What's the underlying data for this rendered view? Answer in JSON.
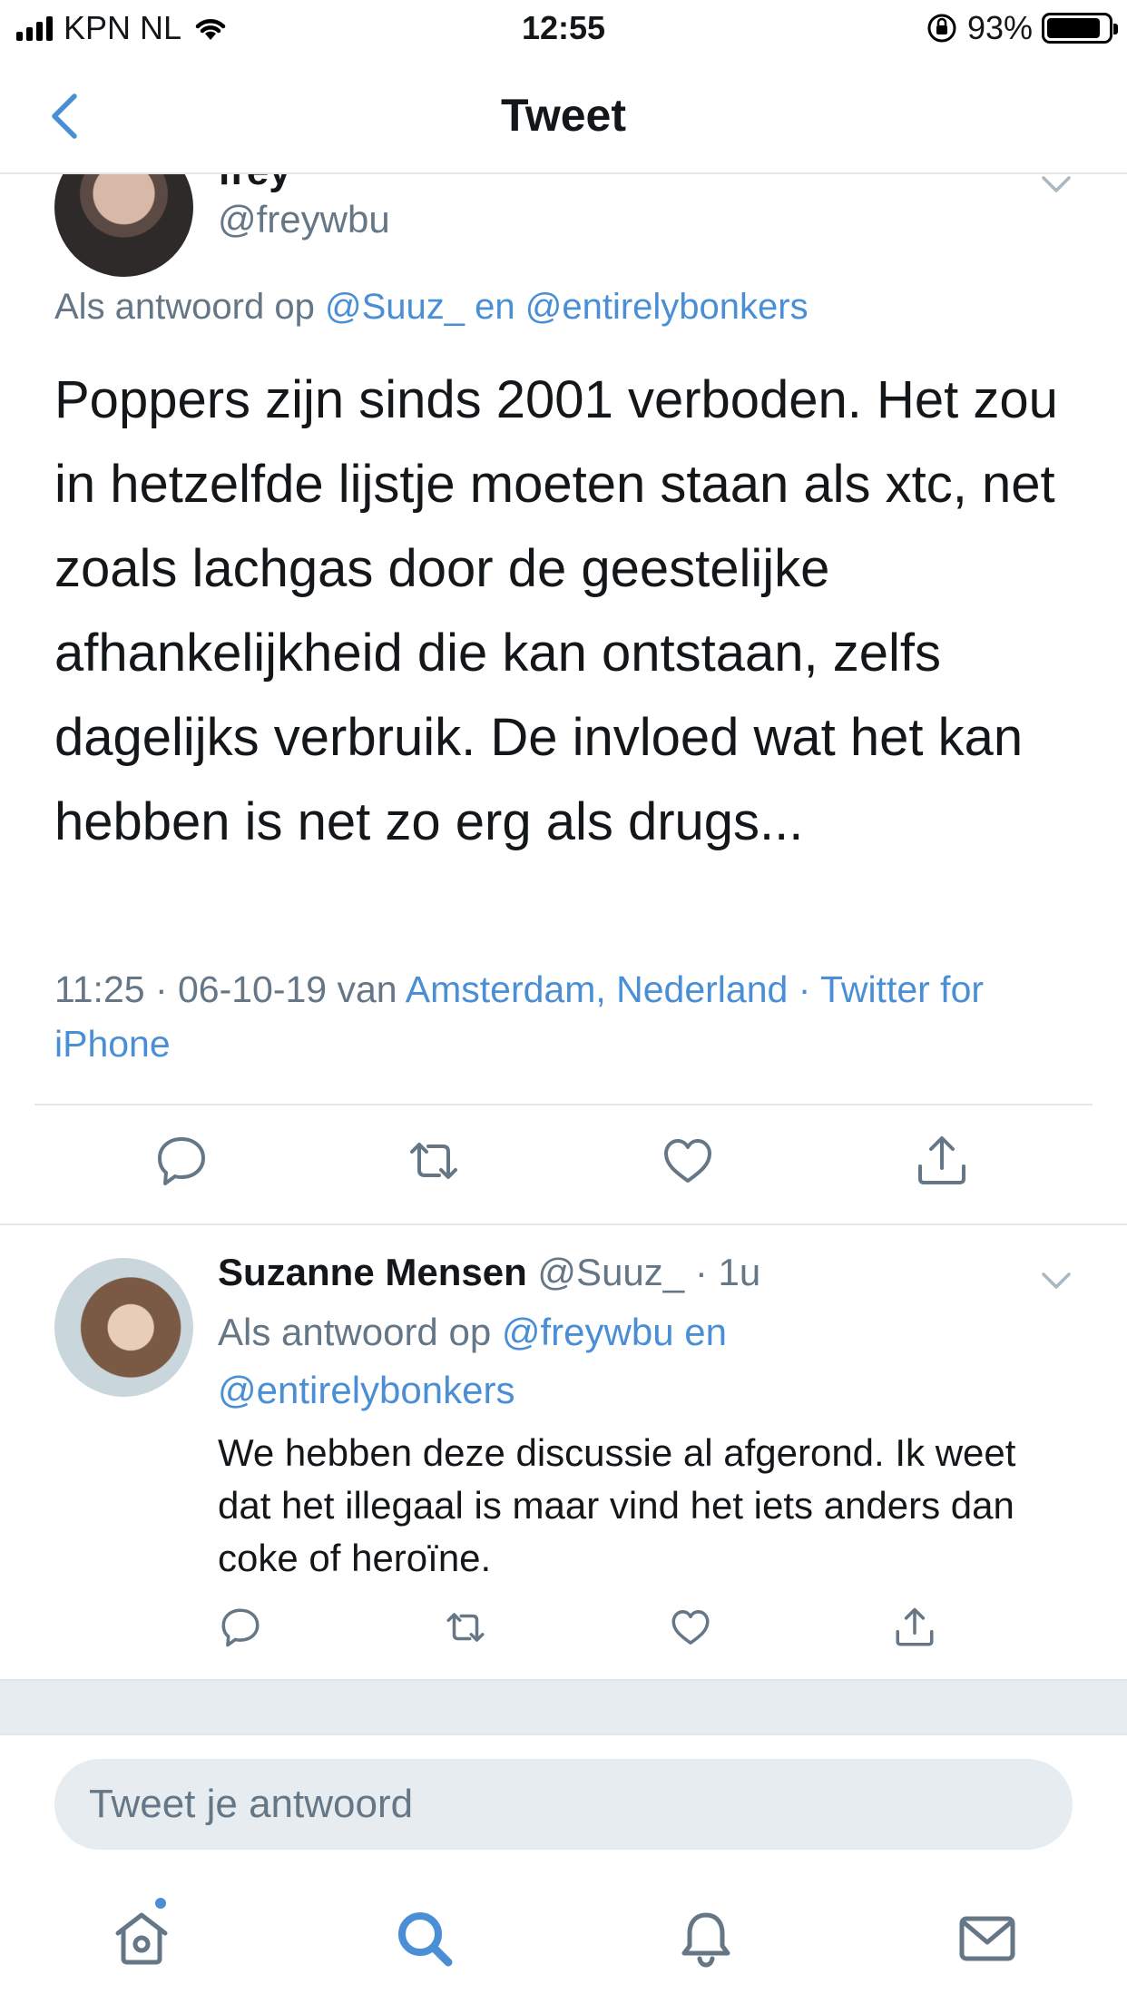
{
  "status_bar": {
    "carrier": "KPN NL",
    "time": "12:55",
    "battery": "93%"
  },
  "nav": {
    "title": "Tweet"
  },
  "main_tweet": {
    "name": "frey",
    "handle": "@freywbu",
    "reply_prefix": "Als antwoord op",
    "reply_user1": "@Suuz_",
    "reply_join": "en",
    "reply_user2": "@entirelybonkers",
    "text": "Poppers zijn sinds 2001 verboden. Het zou in hetzelfde lijstje moeten staan als xtc, net zoals lachgas door de geestelijke afhankelijkheid die kan ontstaan, zelfs dagelijks verbruik. De invloed wat het kan hebben is net zo erg als drugs...",
    "meta_time": "11:25 · 06-10-19 van",
    "meta_location": "Amsterdam, Nederland",
    "meta_sep": "·",
    "meta_client": "Twitter for iPhone"
  },
  "reply_tweet": {
    "name": "Suzanne Mensen",
    "handle": "@Suuz_",
    "age": "· 1u",
    "reply_prefix": "Als antwoord op",
    "reply_user1": "@freywbu",
    "reply_join": "en",
    "reply_user2": "@entirelybonkers",
    "text": "We hebben deze discussie al afgerond. Ik weet dat het illegaal is maar vind het iets anders dan coke of heroïne."
  },
  "composer": {
    "placeholder": "Tweet je antwoord"
  },
  "colors": {
    "accent": "#4a8fd6",
    "secondary_text": "#657786",
    "divider": "#e1e8ed"
  },
  "icons": [
    "back-chevron-icon",
    "reply-icon",
    "retweet-icon",
    "like-icon",
    "share-icon",
    "home-icon",
    "search-icon",
    "notifications-icon",
    "messages-icon"
  ]
}
